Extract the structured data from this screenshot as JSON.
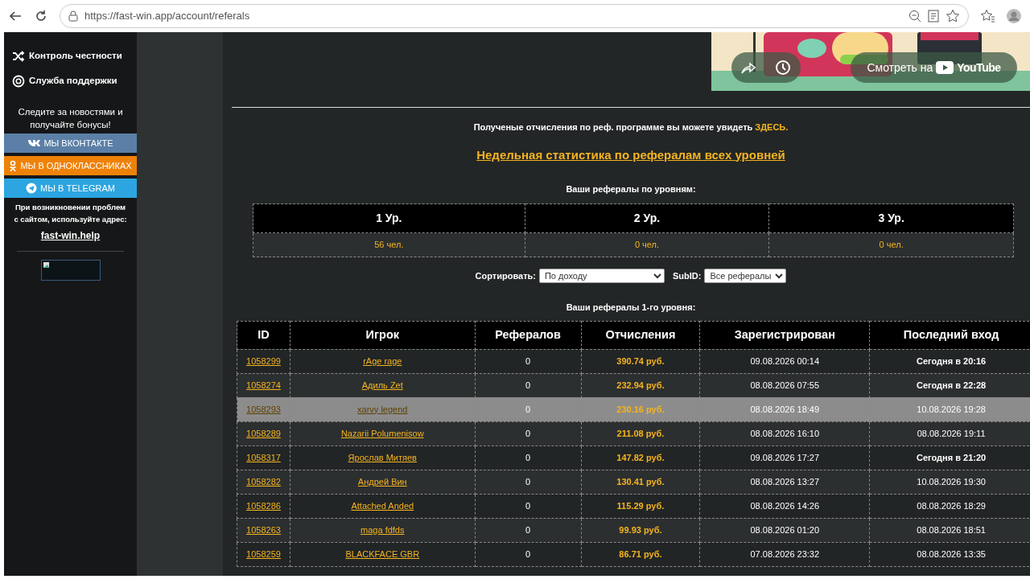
{
  "browser": {
    "url": "https://fast-win.app/account/referals"
  },
  "sidebar": {
    "items": [
      {
        "kind": "shuffle",
        "label": "Контроль честности"
      },
      {
        "kind": "support",
        "label": "Служба поддержки"
      }
    ],
    "follow_text": "Следите за новостями и получайте бонусы!",
    "social": [
      {
        "kind": "vk",
        "label": "МЫ ВКОНТАКТЕ",
        "color": "#5b7fa6"
      },
      {
        "kind": "ok",
        "label": "МЫ В ОДНОКЛАССНИКАХ",
        "color": "#ee8208"
      },
      {
        "kind": "telegram",
        "label": "МЫ В TELEGRAM",
        "color": "#2ca5e0"
      }
    ],
    "problem_text": "При возникновении проблем с сайтом, используйте адрес:",
    "mirror_link": "fast-win.help"
  },
  "video": {
    "kind": "picture",
    "watch_label": "Смотреть на",
    "brand": "YouTube"
  },
  "info_text": "Полученые отчисления по реф. программе вы можете увидеть ",
  "info_link": "ЗДЕСЬ.",
  "weekly_link": "Недельная статистика по рефералам всех уровней",
  "levels": {
    "title": "Ваши рефералы по уровням:",
    "columns": [
      "1 Ур.",
      "2 Ур.",
      "3 Ур."
    ],
    "values": [
      "56 чел.",
      "0 чел.",
      "0 чел."
    ]
  },
  "filters": {
    "sort_label": "Сортировать:",
    "sort_value": "По доходу",
    "subid_label": "SubID:",
    "subid_value": "Все рефералы"
  },
  "table": {
    "title": "Ваши рефералы 1-го уровня:",
    "columns": [
      "ID",
      "Игрок",
      "Рефералов",
      "Отчисления",
      "Зарегистрирован",
      "Последний вход"
    ],
    "rows": [
      {
        "id": "1058299",
        "player": "rAge rage",
        "refs": "0",
        "earn": "390.74 руб.",
        "reg": "09.08.2026 00:14",
        "last": "Сегодня в 20:16",
        "today": true,
        "hovered": false
      },
      {
        "id": "1058274",
        "player": "Адиль Zet",
        "refs": "0",
        "earn": "232.94 руб.",
        "reg": "08.08.2026 07:55",
        "last": "Сегодня в 22:28",
        "today": true,
        "hovered": false
      },
      {
        "id": "1058293",
        "player": "xarvy legend",
        "refs": "0",
        "earn": "230.16 руб.",
        "reg": "08.08.2026 18:49",
        "last": "10.08.2026 19:28",
        "today": false,
        "hovered": true
      },
      {
        "id": "1058289",
        "player": "Nazarii Polumenisow",
        "refs": "0",
        "earn": "211.08 руб.",
        "reg": "08.08.2026 16:10",
        "last": "08.08.2026 19:11",
        "today": false,
        "hovered": false
      },
      {
        "id": "1058317",
        "player": "Ярослав Митяев",
        "refs": "0",
        "earn": "147.82 руб.",
        "reg": "09.08.2026 17:27",
        "last": "Сегодня в 21:20",
        "today": true,
        "hovered": false
      },
      {
        "id": "1058282",
        "player": "Андрей Вин",
        "refs": "0",
        "earn": "130.41 руб.",
        "reg": "08.08.2026 13:27",
        "last": "10.08.2026 19:30",
        "today": false,
        "hovered": false
      },
      {
        "id": "1058286",
        "player": "Attached Anded",
        "refs": "0",
        "earn": "115.29 руб.",
        "reg": "08.08.2026 14:26",
        "last": "08.08.2026 18:29",
        "today": false,
        "hovered": false
      },
      {
        "id": "1058263",
        "player": "maga fdfds",
        "refs": "0",
        "earn": "99.93 руб.",
        "reg": "08.08.2026 01:20",
        "last": "08.08.2026 18:51",
        "today": false,
        "hovered": false
      },
      {
        "id": "1058259",
        "player": "BLACKFACE GBR",
        "refs": "0",
        "earn": "86.71 руб.",
        "reg": "07.08.2026 23:32",
        "last": "08.08.2026 13:35",
        "today": false,
        "hovered": false
      }
    ]
  }
}
